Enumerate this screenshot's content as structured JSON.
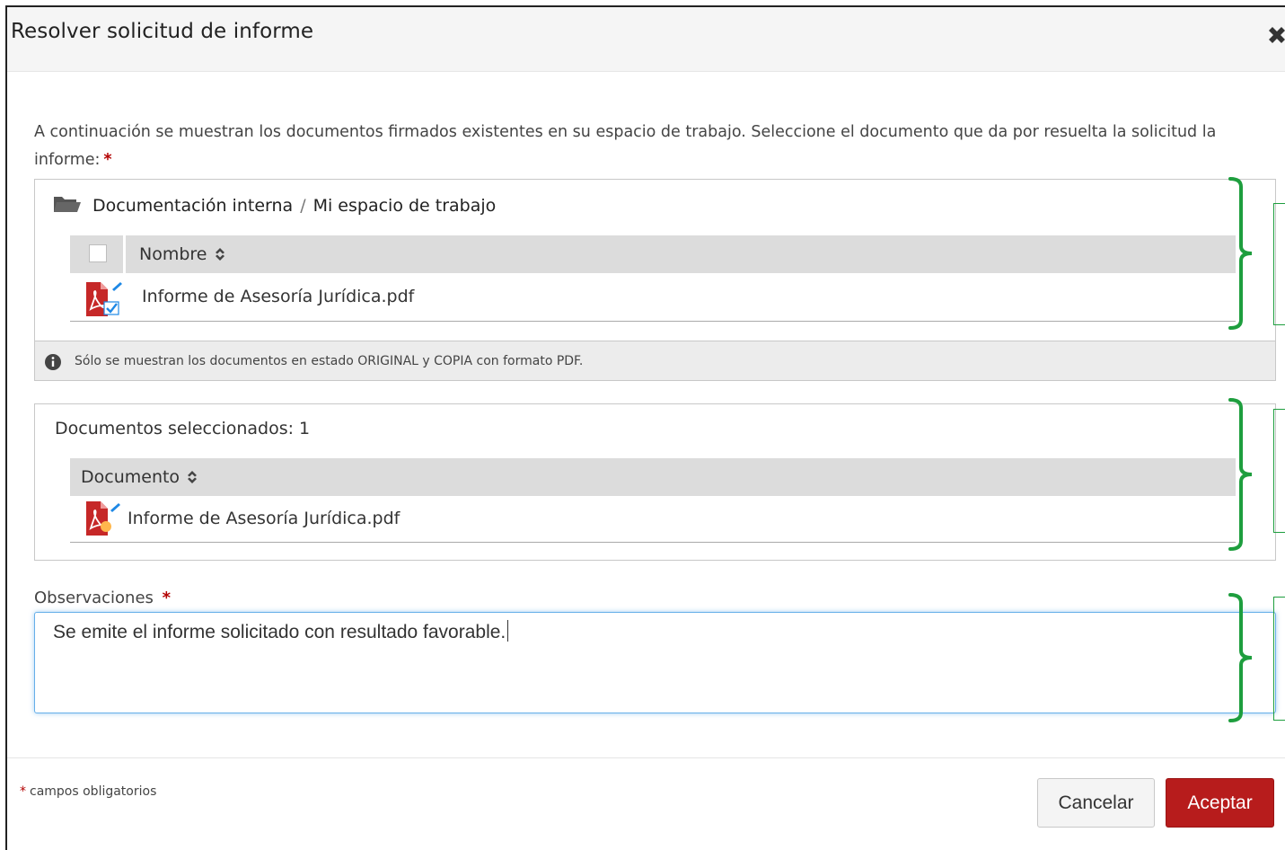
{
  "modal": {
    "title": "Resolver solicitud de informe",
    "close_icon": "close-icon"
  },
  "intro": {
    "text": "A continuación se muestran los documentos firmados existentes en su espacio de trabajo. Seleccione el documento que da por resuelta la solicitud la informe:",
    "required_mark": "*"
  },
  "workspace": {
    "breadcrumb": {
      "folder_icon": "folder-open-icon",
      "root": "Documentación interna",
      "separator": "/",
      "current": "Mi espacio de trabajo"
    },
    "table": {
      "header": {
        "name_label": "Nombre",
        "sort_icon": "sort-icon"
      },
      "rows": [
        {
          "name": "Informe de Asesoría Jurídica.pdf",
          "icon": "signed-pdf-icon"
        }
      ]
    },
    "note": "Sólo se muestran los documentos en estado ORIGINAL y COPIA con formato PDF."
  },
  "selected": {
    "count_label": "Documentos seleccionados: 1",
    "table": {
      "header": {
        "document_label": "Documento",
        "sort_icon": "sort-icon"
      },
      "rows": [
        {
          "name": "Informe de Asesoría Jurídica.pdf",
          "icon": "signed-pdf-icon"
        }
      ]
    }
  },
  "observations": {
    "label": "Observaciones",
    "required_mark": "*",
    "value": "Se emite el informe solicitado con resultado favorable."
  },
  "footer": {
    "required_mark": "*",
    "required_note": "campos obligatorios",
    "cancel_label": "Cancelar",
    "accept_label": "Aceptar"
  },
  "colors": {
    "accept_button": "#b71c1c",
    "annotation_bracket": "#1e9e3e",
    "required_mark": "#b30000",
    "focus_border": "#66afe9"
  }
}
